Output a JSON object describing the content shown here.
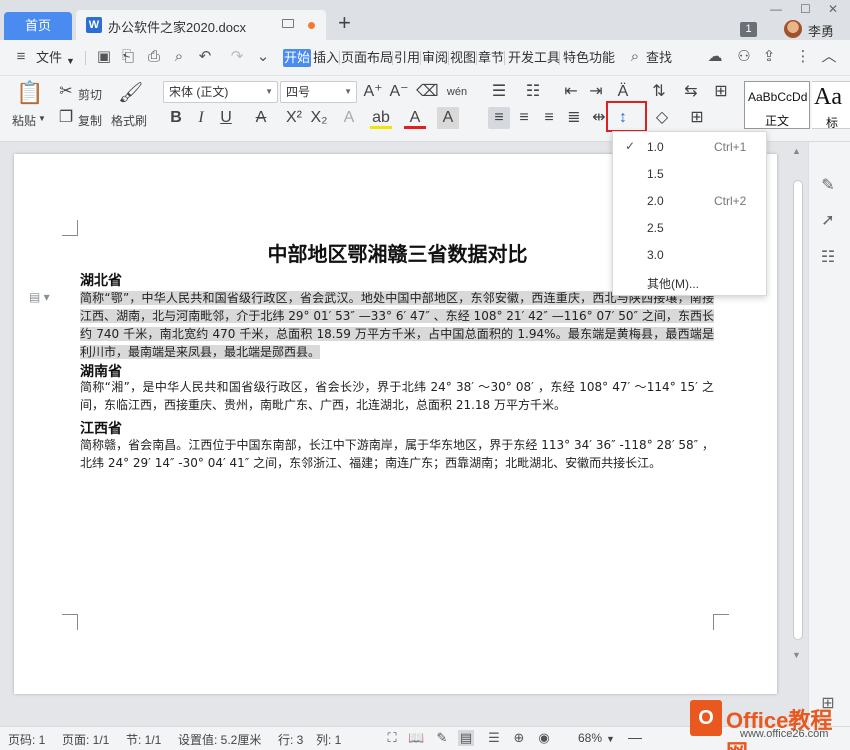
{
  "titlebar": {
    "home_tab": "首页",
    "doc_tab": "办公软件之家2020.docx",
    "doc_icon": "W",
    "new_tab_icon": "+",
    "count_badge": "1",
    "user_name": "李勇"
  },
  "menu": {
    "file": "文件",
    "tabs": [
      "开始",
      "插入",
      "页面布局",
      "引用",
      "审阅",
      "视图",
      "章节",
      "开发工具",
      "特色功能"
    ],
    "search": "查找"
  },
  "ribbon": {
    "paste": "粘贴",
    "cut": "剪切",
    "copy": "复制",
    "format_painter": "格式刷",
    "font_name": "宋体 (正文)",
    "font_size": "四号",
    "style_sample": "AaBbCcDd",
    "style_normal": "正文",
    "style_heading_sample": "Aa",
    "style_heading": "标"
  },
  "document": {
    "title": "中部地区鄂湘赣三省数据对比",
    "sections": [
      {
        "heading": "湖北省",
        "body": "简称“鄂”，中华人民共和国省级行政区，省会武汉。地处中国中部地区，东邻安徽，西连重庆，西北与陕西接壤，南接江西、湖南，北与河南毗邻，介于北纬 29° 01′ 53″ —33° 6′ 47″ 、东经 108° 21′ 42″ —116° 07′ 50″ 之间，东西长约 740 千米，南北宽约 470 千米，总面积 18.59 万平方千米，占中国总面积的 1.94%。最东端是黄梅县，最西端是利川市，最南端是来凤县，最北端是郧西县。"
      },
      {
        "heading": "湖南省",
        "body": "简称“湘”，是中华人民共和国省级行政区，省会长沙，界于北纬 24° 38′ ～30° 08′ ，东经 108° 47′ ～114° 15′ 之间，东临江西，西接重庆、贵州，南毗广东、广西，北连湖北，总面积 21.18 万平方千米。"
      },
      {
        "heading": "江西省",
        "body": "简称赣，省会南昌。江西位于中国东南部，长江中下游南岸，属于华东地区，界于东经 113° 34′ 36″ -118° 28′ 58″ ，北纬 24° 29′ 14″ -30° 04′ 41″ 之间，东邻浙江、福建；南连广东；西靠湖南；北毗湖北、安徽而共接长江。"
      }
    ]
  },
  "line_spacing_menu": {
    "items": [
      {
        "value": "1.0",
        "shortcut": "Ctrl+1",
        "checked": true
      },
      {
        "value": "1.5",
        "shortcut": "",
        "checked": false
      },
      {
        "value": "2.0",
        "shortcut": "Ctrl+2",
        "checked": false
      },
      {
        "value": "2.5",
        "shortcut": "",
        "checked": false
      },
      {
        "value": "3.0",
        "shortcut": "",
        "checked": false
      },
      {
        "value": "其他(M)...",
        "shortcut": "",
        "checked": false
      }
    ]
  },
  "statusbar": {
    "page": "页码: 1",
    "pages": "页面: 1/1",
    "section": "节: 1/1",
    "setting": "设置值: 5.2厘米",
    "row": "行: 3",
    "col": "列: 1",
    "zoom": "68%"
  },
  "watermark": {
    "logo_letter": "O",
    "text": "Office教程网",
    "url": "www.office26.com"
  },
  "colors": {
    "accent": "#4a8bf0",
    "highlight_border": "#e02020",
    "selection": "#d9d9d9",
    "watermark": "#e8581f"
  }
}
